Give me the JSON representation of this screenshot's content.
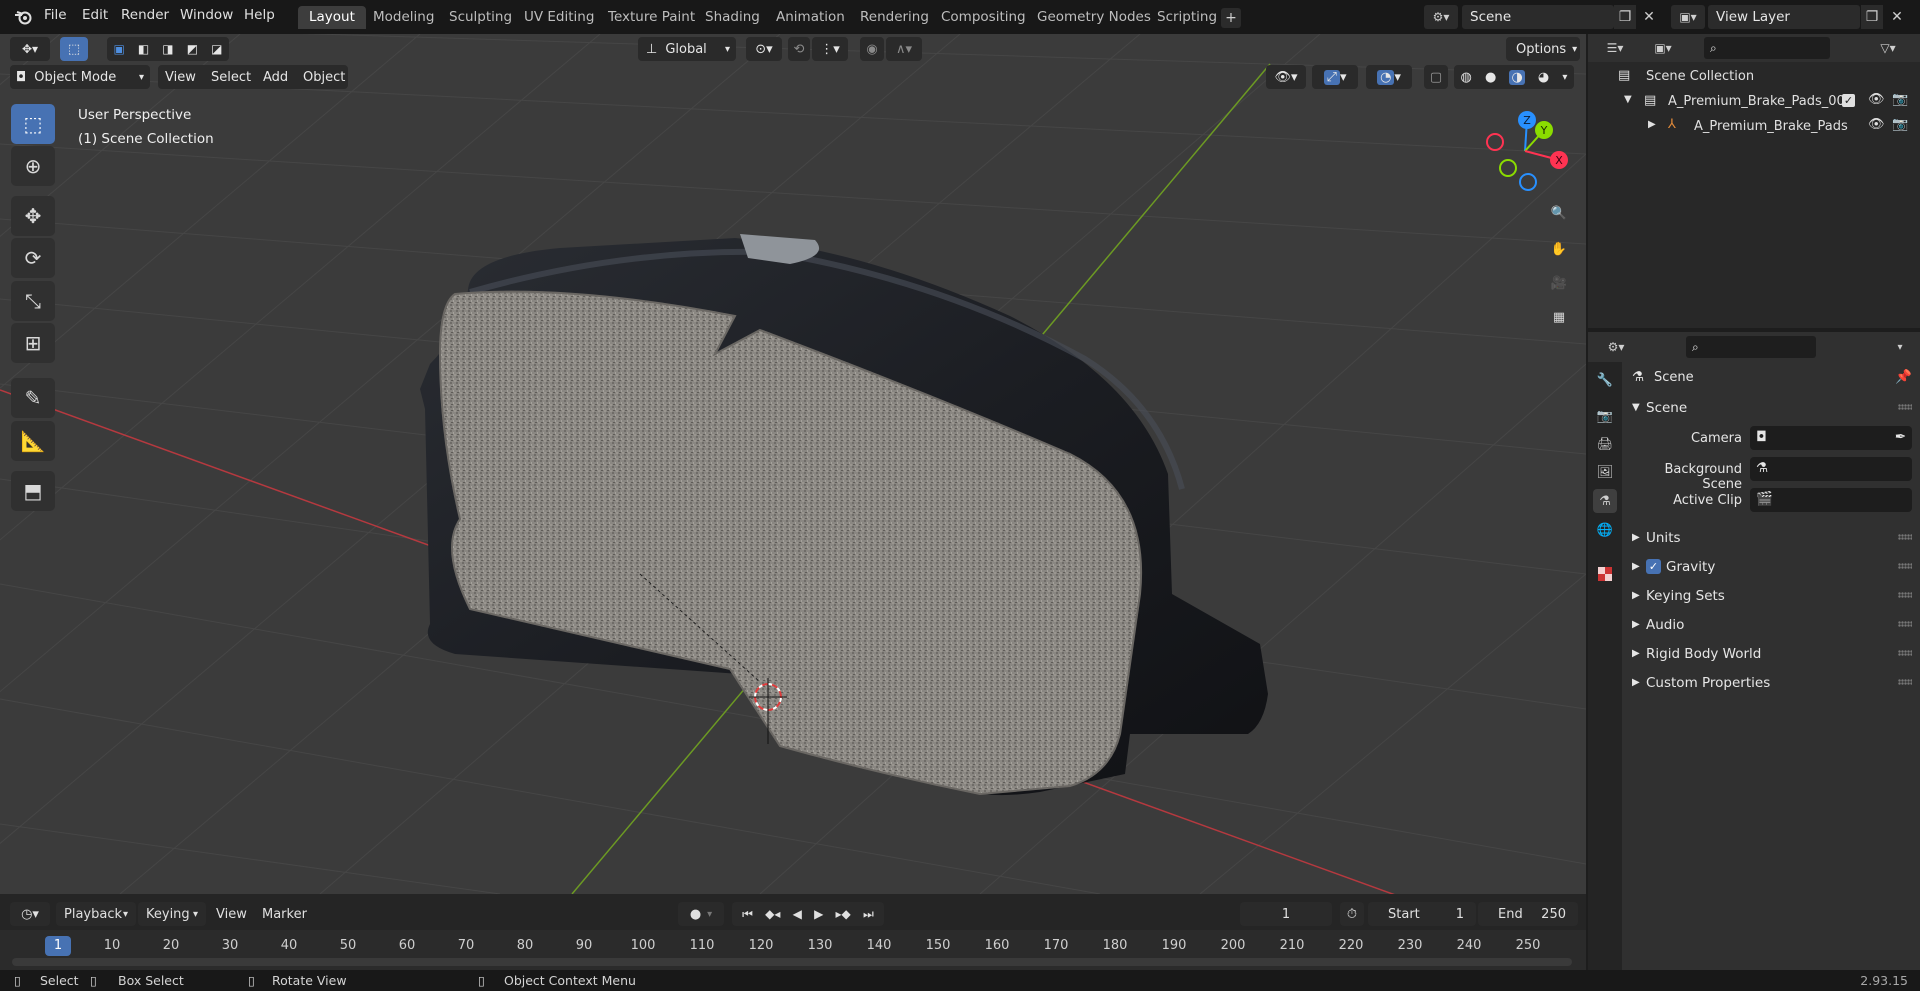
{
  "menu": [
    "File",
    "Edit",
    "Render",
    "Window",
    "Help"
  ],
  "workspace_tabs": [
    "Layout",
    "Modeling",
    "Sculpting",
    "UV Editing",
    "Texture Paint",
    "Shading",
    "Animation",
    "Rendering",
    "Compositing",
    "Geometry Nodes",
    "Scripting"
  ],
  "active_workspace": "Layout",
  "scene_name": "Scene",
  "view_layer": "View Layer",
  "viewport": {
    "mode": "Object Mode",
    "menus": [
      "View",
      "Select",
      "Add",
      "Object"
    ],
    "orientation": "Global",
    "options_label": "Options",
    "view_name": "User Perspective",
    "collection_info": "(1) Scene Collection",
    "gizmo_axes": [
      "Z",
      "Y",
      "X"
    ]
  },
  "timeline": {
    "menus": [
      "Playback",
      "Keying",
      "View",
      "Marker"
    ],
    "current_frame": "1",
    "start_label": "Start",
    "start_value": "1",
    "end_label": "End",
    "end_value": "250",
    "frame_ticks": [
      "1",
      "10",
      "20",
      "30",
      "40",
      "50",
      "60",
      "70",
      "80",
      "90",
      "100",
      "110",
      "120",
      "130",
      "140",
      "150",
      "160",
      "170",
      "180",
      "190",
      "200",
      "210",
      "220",
      "230",
      "240",
      "250"
    ]
  },
  "outliner": {
    "root": "Scene Collection",
    "items": [
      {
        "label": "A_Premium_Brake_Pads_001",
        "type": "collection",
        "checked": true
      },
      {
        "label": "A_Premium_Brake_Pads",
        "type": "armature"
      }
    ]
  },
  "properties": {
    "context_title": "Scene",
    "section_title": "Scene",
    "fields": [
      {
        "label": "Camera"
      },
      {
        "label": "Background Scene"
      },
      {
        "label": "Active Clip"
      }
    ],
    "panels": [
      {
        "label": "Units",
        "checkbox": false
      },
      {
        "label": "Gravity",
        "checkbox": true
      },
      {
        "label": "Keying Sets",
        "checkbox": false
      },
      {
        "label": "Audio",
        "checkbox": false
      },
      {
        "label": "Rigid Body World",
        "checkbox": false
      },
      {
        "label": "Custom Properties",
        "checkbox": false
      }
    ]
  },
  "statusbar": {
    "select": "Select",
    "box_select": "Box Select",
    "rotate_view": "Rotate View",
    "context_menu": "Object Context Menu",
    "version": "2.93.15"
  },
  "colors": {
    "accent": "#4772b3",
    "x_axis": "#ff3352",
    "y_axis": "#8bdc00",
    "z_axis": "#2890ff",
    "viewport_bg": "#3b3b3b"
  }
}
